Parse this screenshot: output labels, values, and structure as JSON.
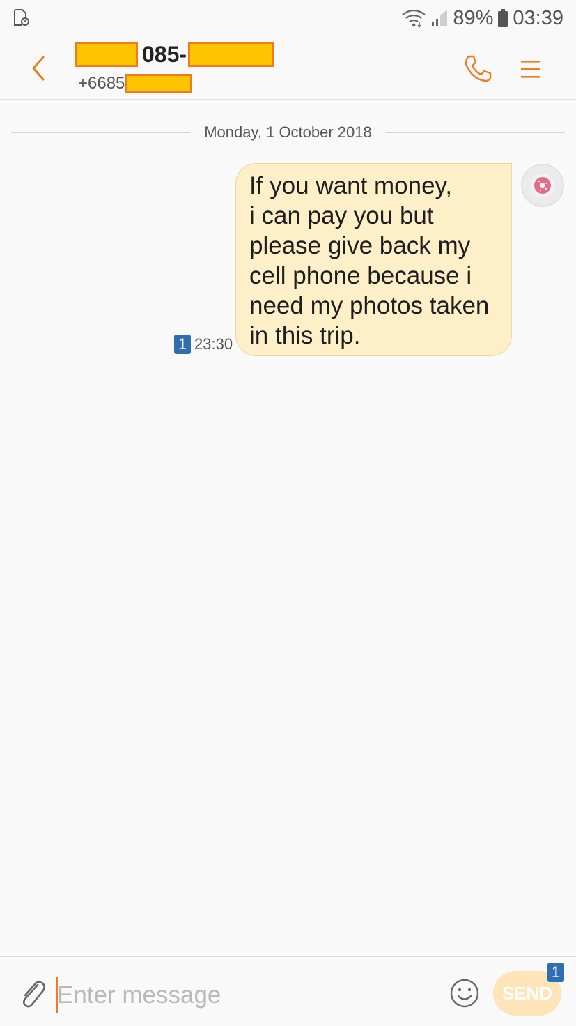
{
  "status_bar": {
    "battery": "89%",
    "time": "03:39",
    "icons": [
      "sim-card-clock-icon",
      "wifi-icon",
      "signal-icon",
      "battery-icon"
    ]
  },
  "header": {
    "title_visible": "085-",
    "subtitle_prefix": "+6685",
    "accent_color": "#f07a21",
    "redaction_color": "#ffc400"
  },
  "conversation": {
    "date_divider": "Monday, 1 October 2018",
    "messages": [
      {
        "text": "If you want money,\ni can pay you but\nplease give back my\ncell phone because i\nneed my photos taken\nin this trip.",
        "time": "23:30",
        "sim": "1",
        "direction": "sent"
      }
    ]
  },
  "composer": {
    "placeholder": "Enter message",
    "send_label": "SEND",
    "send_sim": "1"
  }
}
